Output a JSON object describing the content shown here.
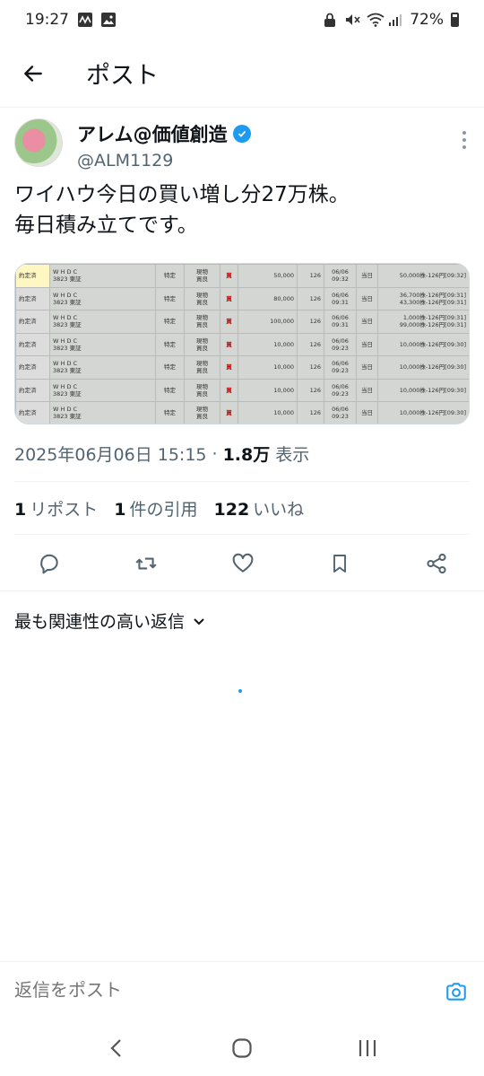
{
  "status_bar": {
    "time": "19:27",
    "battery": "72%"
  },
  "header": {
    "title": "ポスト"
  },
  "tweet": {
    "display_name": "アレム@価値創造",
    "handle": "@ALM1129",
    "text_line1": "ワイハウ今日の買い増し分27万株。",
    "text_line2": "毎日積み立てです。",
    "time": "2025年06月06日 15:15",
    "views_count": "1.8万",
    "views_label": "表示"
  },
  "order_table": {
    "rows": [
      {
        "status": "約定済",
        "name": "W H D C",
        "code": "3823 東証",
        "account": "特定",
        "type1": "現物",
        "type2": "買良",
        "side": "買",
        "qty": "50,000",
        "price": "126",
        "date": "06/06",
        "time": "09:32",
        "term": "当日",
        "exec1": "50,000株-126円[09:32]",
        "exec2": ""
      },
      {
        "status": "約定済",
        "name": "W H D C",
        "code": "3823 東証",
        "account": "特定",
        "type1": "現物",
        "type2": "買良",
        "side": "買",
        "qty": "80,000",
        "price": "126",
        "date": "06/06",
        "time": "09:31",
        "term": "当日",
        "exec1": "36,700株-126円[09:31]",
        "exec2": "43,300株-126円[09:31]"
      },
      {
        "status": "約定済",
        "name": "W H D C",
        "code": "3823 東証",
        "account": "特定",
        "type1": "現物",
        "type2": "買良",
        "side": "買",
        "qty": "100,000",
        "price": "126",
        "date": "06/06",
        "time": "09:31",
        "term": "当日",
        "exec1": "1,000株-126円[09:31]",
        "exec2": "99,000株-126円[09:31]"
      },
      {
        "status": "約定済",
        "name": "W H D C",
        "code": "3823 東証",
        "account": "特定",
        "type1": "現物",
        "type2": "買良",
        "side": "買",
        "qty": "10,000",
        "price": "126",
        "date": "06/06",
        "time": "09:23",
        "term": "当日",
        "exec1": "10,000株-126円[09:30]",
        "exec2": ""
      },
      {
        "status": "約定済",
        "name": "W H D C",
        "code": "3823 東証",
        "account": "特定",
        "type1": "現物",
        "type2": "買良",
        "side": "買",
        "qty": "10,000",
        "price": "126",
        "date": "06/06",
        "time": "09:23",
        "term": "当日",
        "exec1": "10,000株-126円[09:30]",
        "exec2": ""
      },
      {
        "status": "約定済",
        "name": "W H D C",
        "code": "3823 東証",
        "account": "特定",
        "type1": "現物",
        "type2": "買良",
        "side": "買",
        "qty": "10,000",
        "price": "126",
        "date": "06/06",
        "time": "09:23",
        "term": "当日",
        "exec1": "10,000株-126円[09:30]",
        "exec2": ""
      },
      {
        "status": "約定済",
        "name": "W H D C",
        "code": "3823 東証",
        "account": "特定",
        "type1": "現物",
        "type2": "買良",
        "side": "買",
        "qty": "10,000",
        "price": "126",
        "date": "06/06",
        "time": "09:23",
        "term": "当日",
        "exec1": "10,000株-126円[09:30]",
        "exec2": ""
      }
    ]
  },
  "stats": {
    "reposts_count": "1",
    "reposts_label": "リポスト",
    "quotes_count": "1",
    "quotes_label": "件の引用",
    "likes_count": "122",
    "likes_label": "いいね"
  },
  "replies": {
    "sort_label": "最も関連性の高い返信"
  },
  "reply_bar": {
    "placeholder": "返信をポスト"
  },
  "colors": {
    "accent": "#1d9bf0",
    "text": "#0f1419",
    "muted": "#536471"
  }
}
